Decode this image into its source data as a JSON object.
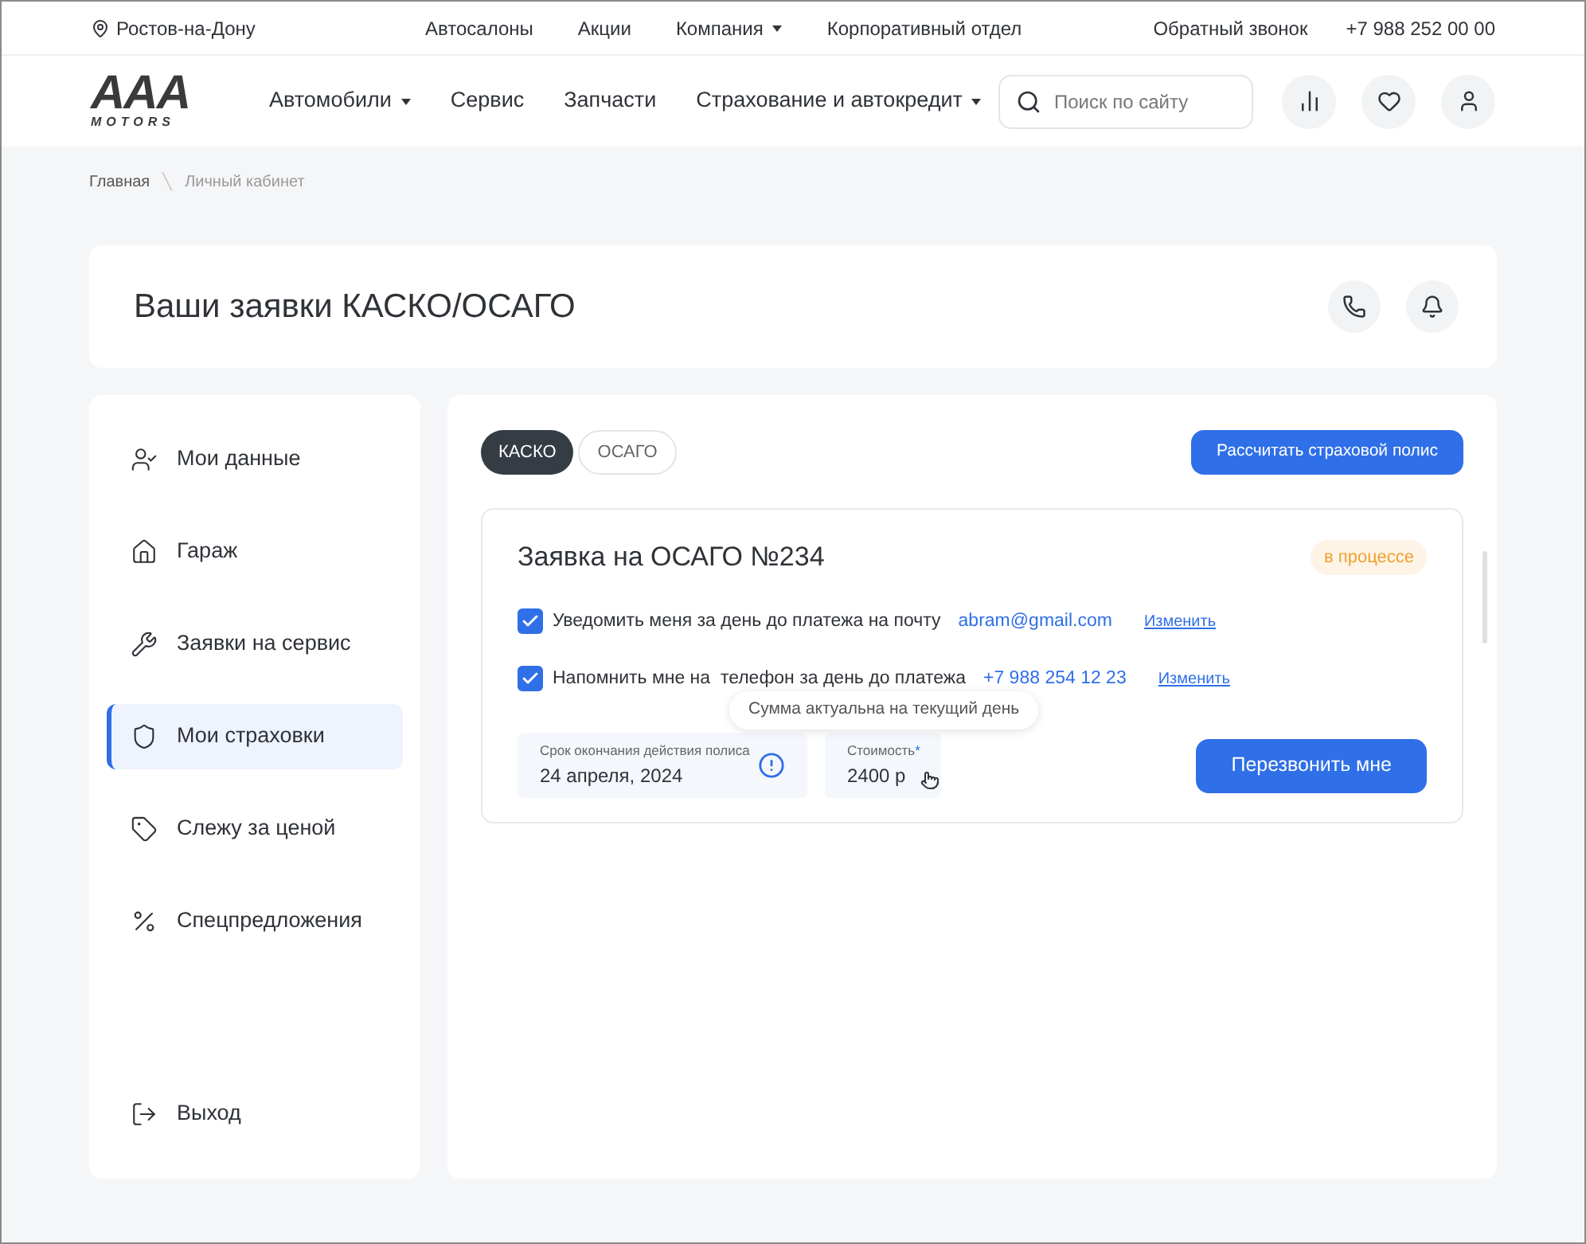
{
  "topbar": {
    "city": "Ростов-на-Дону",
    "links": [
      {
        "label": "Автосалоны",
        "dropdown": false
      },
      {
        "label": "Акции",
        "dropdown": false
      },
      {
        "label": "Компания",
        "dropdown": true
      },
      {
        "label": "Корпоративный отдел",
        "dropdown": false
      }
    ],
    "callback": "Обратный звонок",
    "phone": "+7 988 252 00 00"
  },
  "header": {
    "logo": {
      "letters": "AAA",
      "sub": "MOTORS"
    },
    "nav": [
      {
        "label": "Автомобили",
        "dropdown": true
      },
      {
        "label": "Сервис",
        "dropdown": false
      },
      {
        "label": "Запчасти",
        "dropdown": false
      },
      {
        "label": "Страхование и автокредит",
        "dropdown": true
      }
    ],
    "search": {
      "placeholder": "Поиск по сайту"
    }
  },
  "breadcrumbs": [
    "Главная",
    "Личный кабинет"
  ],
  "page_title": "Ваши заявки КАСКО/ОСАГО",
  "sidebar": {
    "items": [
      {
        "kind": "user",
        "label": "Мои данные",
        "selected": false
      },
      {
        "kind": "home",
        "label": "Гараж",
        "selected": false
      },
      {
        "kind": "wrench",
        "label": "Заявки на сервис",
        "selected": false
      },
      {
        "kind": "shield",
        "label": "Мои страховки",
        "selected": true
      },
      {
        "kind": "tag",
        "label": "Слежу за ценой",
        "selected": false
      },
      {
        "kind": "percent",
        "label": "Спецпредложения",
        "selected": false
      }
    ],
    "logout": "Выход"
  },
  "tabs": [
    {
      "label": "КАСКО",
      "selected": true
    },
    {
      "label": "ОСАГО",
      "selected": false
    }
  ],
  "calc_button": "Рассчитать страховой полис",
  "request": {
    "title": "Заявка на ОСАГО №234",
    "status": {
      "label": "в процессе",
      "kind": "in_progress"
    },
    "options": [
      {
        "label": "Уведомить меня за день до платежа на почту",
        "checked": true,
        "contact": "abram@gmail.com",
        "action": "Изменить"
      },
      {
        "label": "Напомнить мне на  телефон за день до платежа",
        "checked": true,
        "contact": "+7 988 254 12 23",
        "action": "Изменить"
      }
    ],
    "tooltip": "Сумма актуальна на текущий день",
    "expiry": {
      "label": "Срок окончания действия полиса",
      "value": "24 апреля, 2024"
    },
    "cost": {
      "label": "Стоимость",
      "mark": "*",
      "value": "2400 р"
    },
    "callback_button": "Перезвонить мне"
  }
}
